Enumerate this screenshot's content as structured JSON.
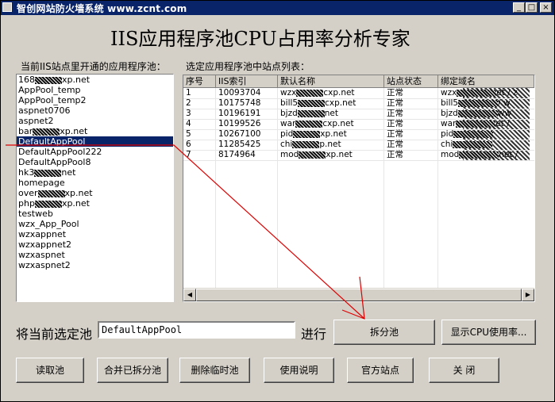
{
  "window": {
    "title": "智创网站防火墙系统 www.zcnt.com",
    "minimize": "_",
    "maximize": "□",
    "close": "×"
  },
  "heading": "IIS应用程序池CPU占用率分析专家",
  "left_panel": {
    "label": "当前IIS站点里开通的应用程序池：",
    "items": [
      {
        "pre": "168",
        "post": "xp.net"
      },
      {
        "pre": "AppPool_temp",
        "post": ""
      },
      {
        "pre": "AppPool_temp2",
        "post": ""
      },
      {
        "pre": "aspnet0706",
        "post": ""
      },
      {
        "pre": "aspnet2",
        "post": ""
      },
      {
        "pre": "bar",
        "post": "xp.net"
      },
      {
        "pre": "DefaultAppPool",
        "post": ""
      },
      {
        "pre": "DefaultAppPool222",
        "post": ""
      },
      {
        "pre": "DefaultAppPool8",
        "post": ""
      },
      {
        "pre": "hk3",
        "post": "net"
      },
      {
        "pre": "homepage",
        "post": ""
      },
      {
        "pre": "over",
        "post": "xp.net"
      },
      {
        "pre": "php",
        "post": "xp.net"
      },
      {
        "pre": "testweb",
        "post": ""
      },
      {
        "pre": "wzx_App_Pool",
        "post": ""
      },
      {
        "pre": "wzxappnet",
        "post": ""
      },
      {
        "pre": "wzxappnet2",
        "post": ""
      },
      {
        "pre": "wzxaspnet",
        "post": ""
      },
      {
        "pre": "wzxaspnet2",
        "post": ""
      }
    ],
    "selected_index": 6
  },
  "right_panel": {
    "label": "选定应用程序池中站点列表：",
    "columns": [
      "序号",
      "IIS索引",
      "默认名称",
      "站点状态",
      "绑定域名"
    ],
    "rows": [
      {
        "no": "1",
        "index": "10093704",
        "name_pre": "wzx",
        "name_post": "cxp.net",
        "status": "正常",
        "domain_pre": "wzx",
        "domain_post": "et / z"
      },
      {
        "no": "2",
        "index": "10175748",
        "name_pre": "bill5",
        "name_post": "cxp.net",
        "status": "正常",
        "domain_pre": "bill5",
        "domain_post": "/ w"
      },
      {
        "no": "3",
        "index": "10196191",
        "name_pre": "bjzd",
        "name_post": "net",
        "status": "正常",
        "domain_pre": "bjzd",
        "domain_post": "ww"
      },
      {
        "no": "4",
        "index": "10199526",
        "name_pre": "war",
        "name_post": "cxp.net",
        "status": "正常",
        "domain_pre": "war",
        "domain_post": "et /"
      },
      {
        "no": "5",
        "index": "10267100",
        "name_pre": "pid",
        "name_post": "xp.net",
        "status": "正常",
        "domain_pre": "pid",
        "domain_post": ""
      },
      {
        "no": "6",
        "index": "11285425",
        "name_pre": "chi",
        "name_post": "p.net",
        "status": "正常",
        "domain_pre": "chi",
        "domain_post": ""
      },
      {
        "no": "7",
        "index": "8174964",
        "name_pre": "mod",
        "name_post": "xp.net",
        "status": "正常",
        "domain_pre": "mod",
        "domain_post": "net /"
      }
    ],
    "scroll_left": "◀",
    "scroll_right": "▶"
  },
  "action_row": {
    "prefix_label": "将当前选定池",
    "pool_value": "DefaultAppPool",
    "suffix_label": "进行",
    "split_button": "拆分池",
    "cpu_button": "显示CPU使用率..."
  },
  "bottom_buttons": {
    "read": "读取池",
    "merge": "合并已拆分池",
    "delete_temp": "删除临时池",
    "help": "使用说明",
    "official": "官方站点",
    "close": "关 闭"
  },
  "annotation_color": "#e00000"
}
